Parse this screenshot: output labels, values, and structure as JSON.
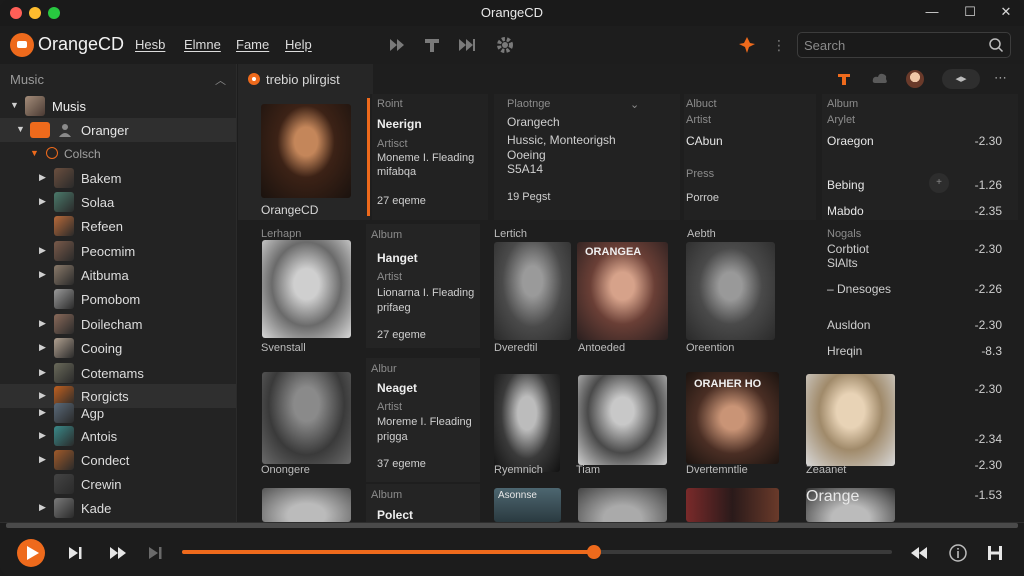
{
  "window": {
    "title": "OrangeCD"
  },
  "app": {
    "name": "OrangeCD"
  },
  "menu": [
    "Hesb",
    "Elmne",
    "Fame",
    "Help"
  ],
  "search": {
    "placeholder": "Search"
  },
  "sidebar": {
    "heading": "Music",
    "root": "Musis",
    "group": "Oranger",
    "subgroup": "Colsch",
    "items": [
      "Bakem",
      "Solaa",
      "Refeen",
      "Peocmim",
      "Aitbuma",
      "Pomobom",
      "Doilecham",
      "Cooing",
      "Cotemams",
      "Rorgicts",
      "Agp",
      "Antois",
      "Condect",
      "Crewin",
      "Kade"
    ]
  },
  "content": {
    "tab_label": "trebio plirgist",
    "header": {
      "caption": "OrangeCD",
      "c1": {
        "label": "Roint",
        "title": "Neerign",
        "artist_label": "Artisct",
        "artist": "Moneme I. Fleading",
        "sub": "mifabqa",
        "count": "27 eqeme"
      },
      "c2": {
        "label": "Plaotnge",
        "line1": "Orangech",
        "line2": "Hussic, Monteorigsh",
        "line3": "Ooeing",
        "line4": "S5A14",
        "count": "19 Pegst"
      },
      "c3": {
        "label": "Albuct",
        "sub": "Artist",
        "title": "CAbun",
        "label2": "Press",
        "value2": "Porroe"
      },
      "c4": {
        "label": "Album",
        "sub": "Arylet",
        "title": "Oraegon",
        "row2": "Bebing",
        "row3": "Mabdo"
      },
      "nums": [
        "-2.30",
        "-1.26",
        "-2.35"
      ]
    },
    "col_labels": {
      "a": "Lerhapn",
      "b": "Lertich",
      "c": "Aebth"
    },
    "captions_r1": [
      "Svenstall",
      "Dveredtil",
      "Antoeded",
      "Oreention"
    ],
    "captions_r2": [
      "Onongere",
      "Ryemnich",
      "Tiam",
      "Dvertemntlie",
      "Zeaanet"
    ],
    "overlays": {
      "r1": "ORANGEA",
      "r2": "ORAHER HO",
      "r3": "Asonnse",
      "r3b": "Orange"
    },
    "album_cards": [
      {
        "label": "Album",
        "title": "Hanget",
        "artist_label": "Artist",
        "artist": "Lionarna I. Fleading",
        "sub": "prifaeg",
        "count": "27 egeme"
      },
      {
        "label": "Albur",
        "title": "Neaget",
        "artist_label": "Artist",
        "artist": "Moreme I. Fleading",
        "sub": "prigga",
        "count": "37 egeme"
      },
      {
        "label": "Album",
        "title": "Polect"
      }
    ],
    "right_list": [
      {
        "label": "Nogals",
        "lines": [
          "Corbtiot",
          "SlAlts"
        ],
        "num": "-2.30"
      },
      {
        "label": "",
        "lines": [
          "– Dnesoges"
        ],
        "num": "-2.26"
      },
      {
        "label": "",
        "lines": [
          "Ausldon"
        ],
        "num": "-2.30"
      },
      {
        "label": "",
        "lines": [
          "Hreqin"
        ],
        "num": "-8.3"
      },
      {
        "label": "",
        "lines": [
          ""
        ],
        "num": "-2.30"
      },
      {
        "label": "",
        "lines": [
          ""
        ],
        "num": "-2.34"
      },
      {
        "label": "",
        "lines": [
          ""
        ],
        "num": "-2.30"
      },
      {
        "label": "",
        "lines": [
          ""
        ],
        "num": "-1.53"
      }
    ]
  },
  "player": {
    "progress": 0.58
  },
  "colors": {
    "accent": "#ee6a1c",
    "bg": "#1d1d1d",
    "panel": "#242424"
  }
}
